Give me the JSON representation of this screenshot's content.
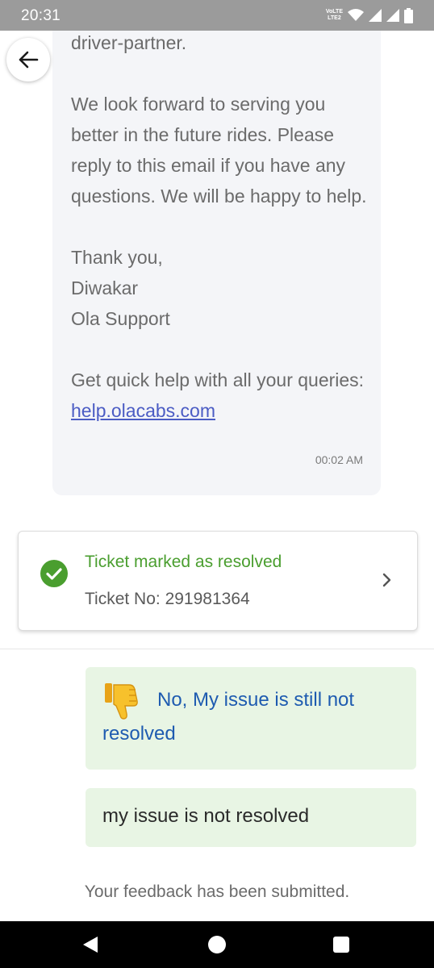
{
  "status_bar": {
    "time": "20:31",
    "volte_line1": "VoLTE",
    "volte_line2": "LTE2"
  },
  "message": {
    "lines": [
      "driver-partner.",
      "",
      "We look forward to serving you better in the future rides. Please reply to this email if you have any questions. We will be happy to help.",
      "",
      "Thank you,",
      "Diwakar",
      "Ola Support",
      "",
      "Get quick help with all your queries:"
    ],
    "partial_top": "driver-partner.",
    "paragraph": "We look forward to serving you better in the future rides. Please reply to this email if you have any questions. We will be happy to help.",
    "signoff": "Thank you,",
    "agent_name": "Diwakar",
    "team": "Ola Support",
    "help_prefix": "Get quick help with all your queries:",
    "help_link": "help.olacabs.com",
    "timestamp": "00:02 AM"
  },
  "ticket": {
    "status": "Ticket marked as resolved",
    "number": "Ticket No: 291981364",
    "status_color": "#4a9e2f"
  },
  "replies": {
    "choice": "No, My issue is still not resolved",
    "comment": "my issue is not resolved"
  },
  "feedback": "Your feedback has been submitted.",
  "icons": {
    "back": "arrow-left-icon",
    "check": "check-circle-icon",
    "chevron": "chevron-right-icon",
    "thumbs": "thumbs-down-icon"
  },
  "colors": {
    "status_bar": "#9b9b9b",
    "bubble": "#f4f5f8",
    "reply_bg": "#e8f5e4",
    "link": "#4b5cc4",
    "reply_text": "#1e5bb0"
  }
}
